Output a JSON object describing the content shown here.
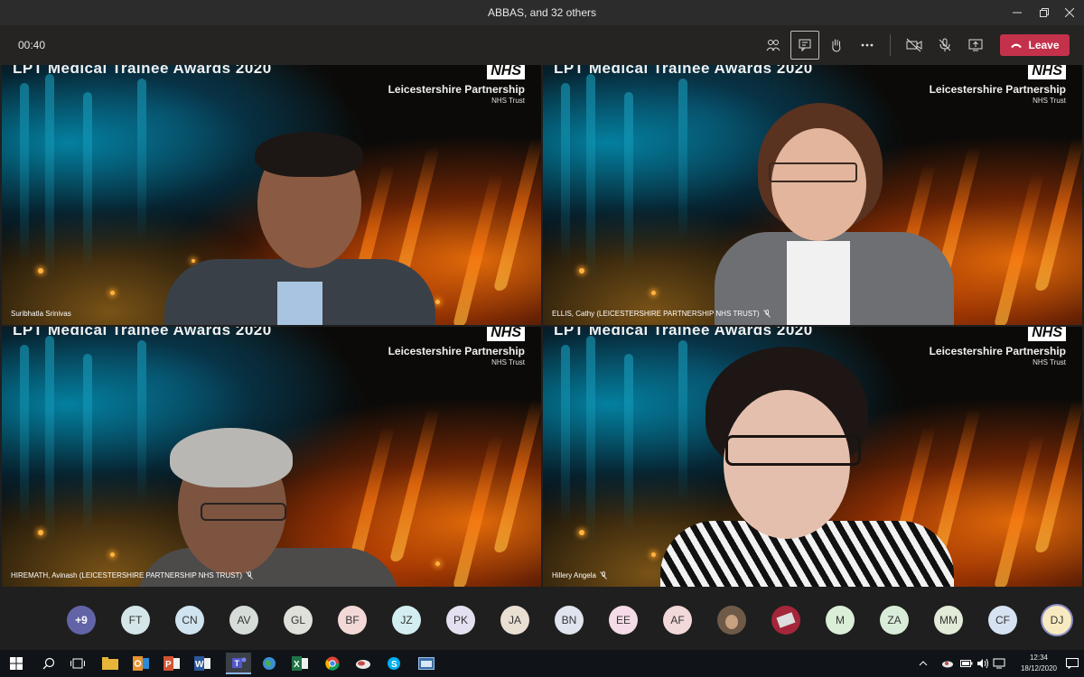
{
  "window": {
    "title": "ABBAS, and 32 others"
  },
  "toolbar": {
    "timer": "00:40",
    "leave_label": "Leave"
  },
  "tiles": [
    {
      "event": "LPT Medical Trainee Awards 2020",
      "logo": "NHS",
      "org": "Leicestershire Partnership",
      "org_sub": "NHS Trust",
      "name": "Suribhatla Srinivas",
      "muted": false
    },
    {
      "event": "LPT Medical Trainee Awards 2020",
      "logo": "NHS",
      "org": "Leicestershire Partnership",
      "org_sub": "NHS Trust",
      "name": "ELLIS, Cathy (LEICESTERSHIRE PARTNERSHIP NHS TRUST)",
      "muted": true
    },
    {
      "event": "LPT Medical Trainee Awards 2020",
      "logo": "NHS",
      "org": "Leicestershire Partnership",
      "org_sub": "NHS Trust",
      "name": "HIREMATH, Avinash (LEICESTERSHIRE PARTNERSHIP NHS TRUST)",
      "muted": true
    },
    {
      "event": "LPT Medical Trainee Awards 2020",
      "logo": "NHS",
      "org": "Leicestershire Partnership",
      "org_sub": "NHS Trust",
      "name": "Hillery Angela",
      "muted": true
    }
  ],
  "roster": {
    "overflow": "+9",
    "avatars": [
      {
        "initials": "FT",
        "color": "#d4e6e8"
      },
      {
        "initials": "CN",
        "color": "#cfe4ef"
      },
      {
        "initials": "AV",
        "color": "#d6dcd8"
      },
      {
        "initials": "GL",
        "color": "#dfe0da"
      },
      {
        "initials": "BF",
        "color": "#f2d9d7"
      },
      {
        "initials": "JZ",
        "color": "#d3eef0"
      },
      {
        "initials": "PK",
        "color": "#e4e0f0"
      },
      {
        "initials": "JA",
        "color": "#eadfd3"
      },
      {
        "initials": "BN",
        "color": "#dfe4ee"
      },
      {
        "initials": "EE",
        "color": "#f5dbe7"
      },
      {
        "initials": "AF",
        "color": "#f2d8d8"
      },
      {
        "initials": "",
        "color": "#6f5a48"
      },
      {
        "initials": "",
        "color": "#a3263a"
      },
      {
        "initials": "M",
        "color": "#dbeed8"
      },
      {
        "initials": "ZA",
        "color": "#d9ecd9"
      },
      {
        "initials": "MM",
        "color": "#e2ead8"
      },
      {
        "initials": "CF",
        "color": "#d6e2f1"
      },
      {
        "initials": "DJ",
        "color": "#f7eac0"
      }
    ]
  },
  "taskbar": {
    "time": "12:34",
    "date": "18/12/2020"
  },
  "colors": {
    "leave": "#c4314b",
    "overflow_avatar": "#6264a7"
  }
}
